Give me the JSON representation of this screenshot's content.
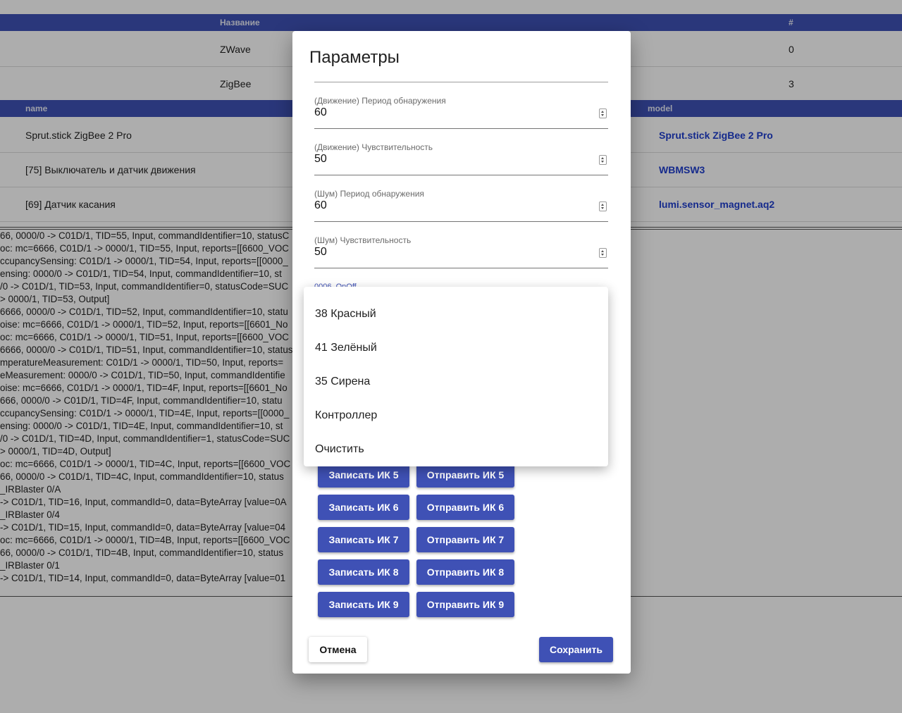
{
  "networks": {
    "header": {
      "name": "Название",
      "num": "#"
    },
    "rows": [
      {
        "name": "ZWave",
        "num": "0"
      },
      {
        "name": "ZigBee",
        "num": "3"
      }
    ]
  },
  "devices": {
    "header": {
      "name": "name",
      "model": "model"
    },
    "rows": [
      {
        "name": "Sprut.stick ZigBee 2 Pro",
        "model": "Sprut.stick ZigBee 2 Pro"
      },
      {
        "name": "[75] Выключатель и датчик движения",
        "model": "WBMSW3"
      },
      {
        "name": "[69] Датчик касания",
        "model": "lumi.sensor_magnet.aq2"
      }
    ]
  },
  "log": [
    "66, 0000/0 -> C01D/1, TID=55, Input, commandIdentifier=10, statusC",
    "oc: mc=6666, C01D/1 -> 0000/1, TID=55, Input, reports=[[6600_VOC",
    "ccupancySensing: C01D/1 -> 0000/1, TID=54, Input, reports=[[0000_",
    "ensing: 0000/0 -> C01D/1, TID=54, Input, commandIdentifier=10, st",
    "/0 -> C01D/1, TID=53, Input, commandIdentifier=0, statusCode=SUC",
    "> 0000/1, TID=53, Output]",
    "6666, 0000/0 -> C01D/1, TID=52, Input, commandIdentifier=10, statu",
    "oise: mc=6666, C01D/1 -> 0000/1, TID=52, Input, reports=[[6601_No",
    "oc: mc=6666, C01D/1 -> 0000/1, TID=51, Input, reports=[[6600_VOC",
    "6666, 0000/0 -> C01D/1, TID=51, Input, commandIdentifier=10, status",
    "mperatureMeasurement: C01D/1 -> 0000/1, TID=50, Input, reports=",
    "eMeasurement: 0000/0 -> C01D/1, TID=50, Input, commandIdentifie",
    "oise: mc=6666, C01D/1 -> 0000/1, TID=4F, Input, reports=[[6601_No",
    "666, 0000/0 -> C01D/1, TID=4F, Input, commandIdentifier=10, statu",
    "ccupancySensing: C01D/1 -> 0000/1, TID=4E, Input, reports=[[0000_",
    "ensing: 0000/0 -> C01D/1, TID=4E, Input, commandIdentifier=10, st",
    "/0 -> C01D/1, TID=4D, Input, commandIdentifier=1, statusCode=SUC",
    "> 0000/1, TID=4D, Output]",
    "oc: mc=6666, C01D/1 -> 0000/1, TID=4C, Input, reports=[[6600_VOC",
    "66, 0000/0 -> C01D/1, TID=4C, Input, commandIdentifier=10, status",
    "_IRBlaster 0/A",
    " -> C01D/1, TID=16, Input, commandId=0, data=ByteArray [value=0A",
    "_IRBlaster 0/4",
    " -> C01D/1, TID=15, Input, commandId=0, data=ByteArray [value=04",
    "oc: mc=6666, C01D/1 -> 0000/1, TID=4B, Input, reports=[[6600_VOC",
    "66, 0000/0 -> C01D/1, TID=4B, Input, commandIdentifier=10, status",
    "_IRBlaster 0/1",
    " -> C01D/1, TID=14, Input, commandId=0, data=ByteArray [value=01"
  ],
  "dialog": {
    "title": "Параметры",
    "fields": [
      {
        "label": "(Движение) Период обнаружения",
        "value": "60"
      },
      {
        "label": "(Движение) Чувствительность",
        "value": "50"
      },
      {
        "label": "(Шум) Период обнаружения",
        "value": "60"
      },
      {
        "label": "(Шум) Чувствительность",
        "value": "50"
      }
    ],
    "select_label": "0006_OnOff",
    "ir_buttons": [
      {
        "record": "Записать ИК 5",
        "send": "Отправить ИК 5"
      },
      {
        "record": "Записать ИК 6",
        "send": "Отправить ИК 6"
      },
      {
        "record": "Записать ИК 7",
        "send": "Отправить ИК 7"
      },
      {
        "record": "Записать ИК 8",
        "send": "Отправить ИК 8"
      },
      {
        "record": "Записать ИК 9",
        "send": "Отправить ИК 9"
      }
    ],
    "cancel": "Отмена",
    "save": "Сохранить"
  },
  "dropdown": {
    "options": [
      "38 Красный",
      "41 Зелёный",
      "35 Сирена",
      "Контроллер",
      "Очистить"
    ]
  },
  "colors": {
    "primary": "#3f51b5",
    "link": "#1f3fcf",
    "overlay": "rgba(0,0,0,0.32)"
  }
}
